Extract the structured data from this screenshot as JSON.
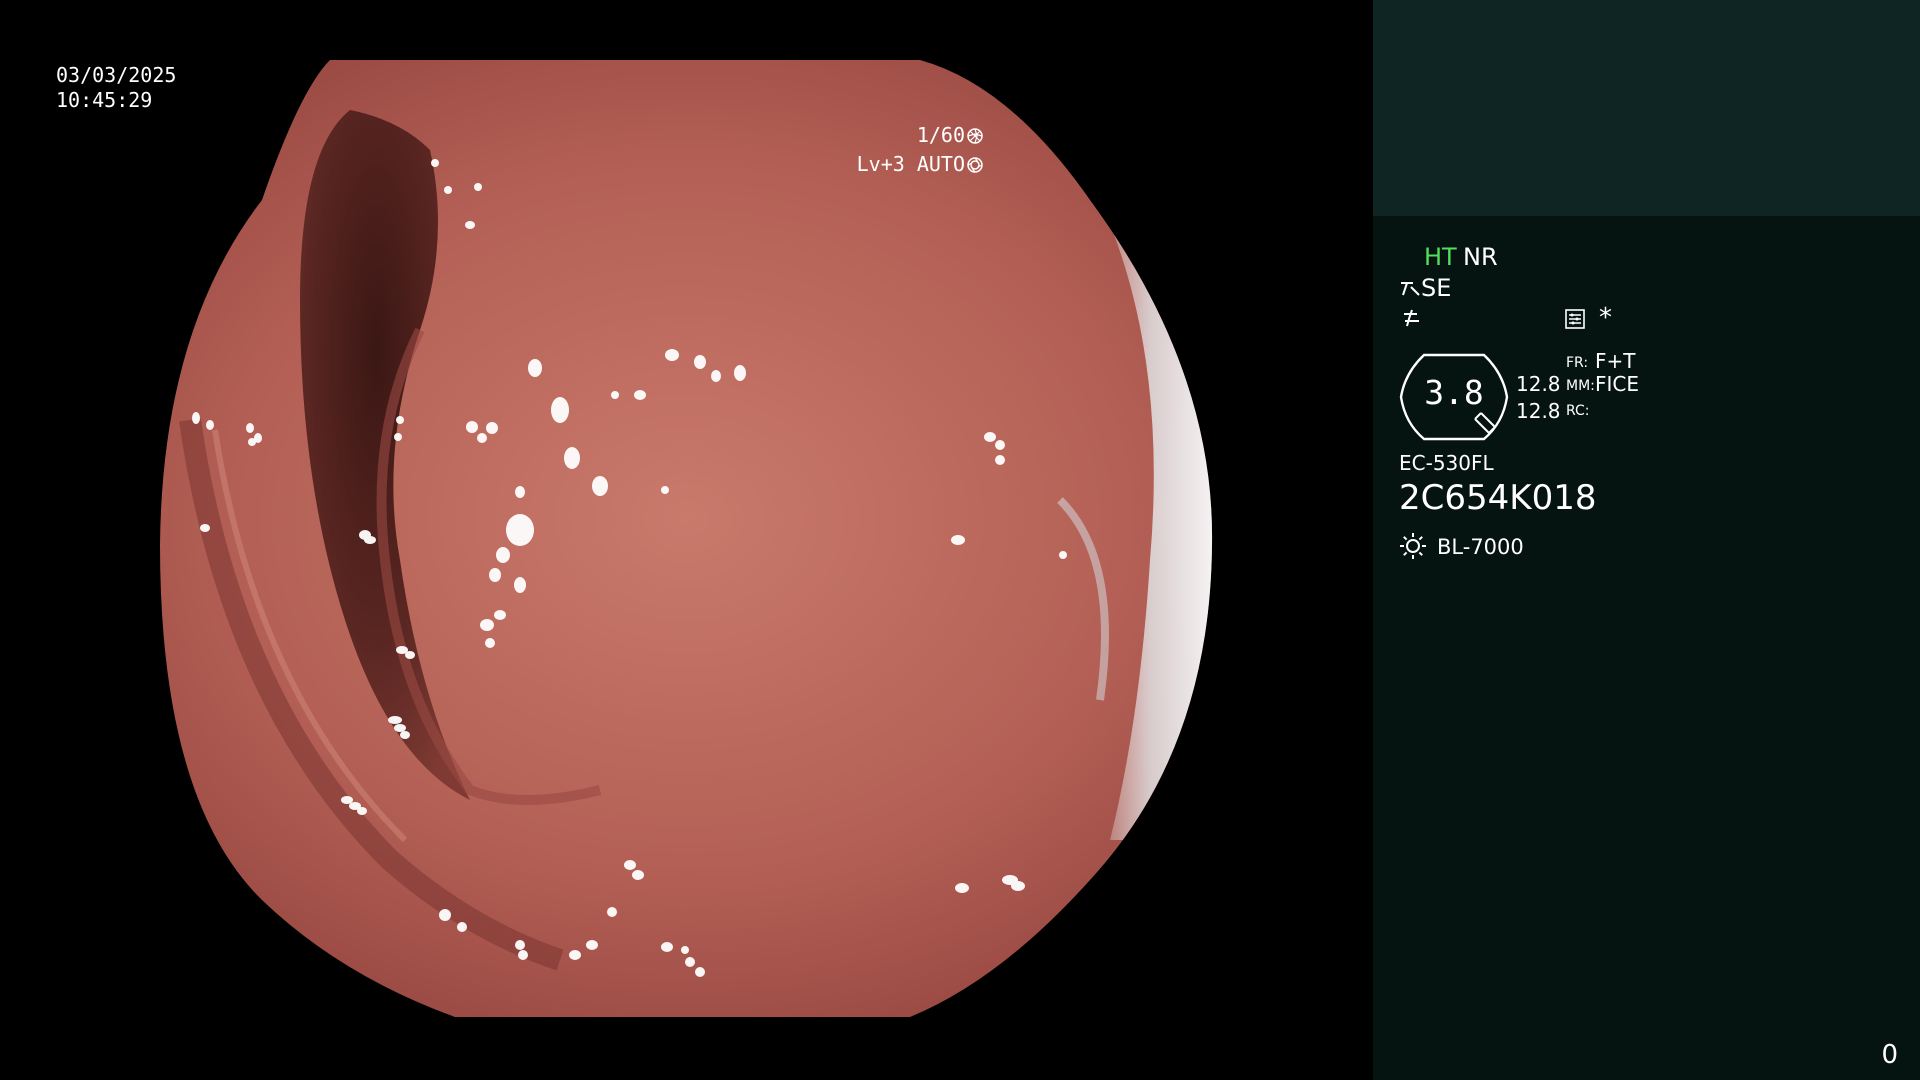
{
  "scope_overlay": {
    "date": "03/03/2025",
    "time": "10:45:29",
    "shutter_speed": "1/60",
    "shutter_icon": "shutter-icon",
    "light_level": "Lv+3",
    "iris_mode": "AUTO",
    "iris_icon": "iris-icon"
  },
  "info_panel": {
    "hue": "HT",
    "noise_reduction": "NR",
    "structure_enhancement": "SE",
    "structure_icon": "structure-enhancement-icon",
    "edge_icon": "edge-enhancement-icon",
    "memo_icon": "memo-icon",
    "star": "*",
    "zoom": {
      "value": "3.8",
      "value_top": "12.8",
      "value_bottom": "12.8"
    },
    "mode_fr_key": "FR:",
    "mode_fr_value": "F+T",
    "mode_mm_key": "MM:",
    "mode_mm_value": "FICE",
    "mode_rc_key": "RC:",
    "scope_model": "EC-530FL",
    "serial_number": "2C654K018",
    "light_source": "BL-7000",
    "light_icon": "light-source-icon",
    "counter": "0"
  },
  "colors": {
    "hue_label": "#52e05c",
    "panel_bg": "#061411",
    "panel_header_bg": "#0f2523",
    "mucosa": "#b8625a"
  }
}
